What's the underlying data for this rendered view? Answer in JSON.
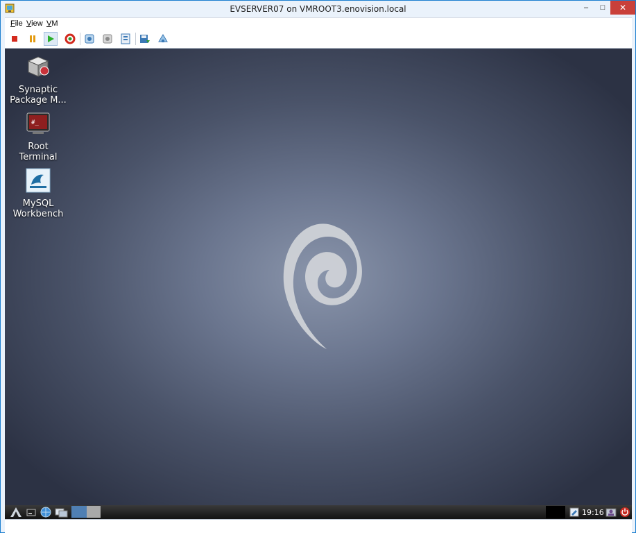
{
  "window": {
    "title": "EVSERVER07 on VMROOT3.enovision.local",
    "controls": {
      "minimize": "‒",
      "maximize": "□",
      "close": "✕"
    }
  },
  "menu": [
    {
      "label": "File",
      "key": "F",
      "rest": "ile"
    },
    {
      "label": "View",
      "key": "V",
      "rest": "iew"
    },
    {
      "label": "VM",
      "key": "V",
      "rest": "M"
    }
  ],
  "toolbar": {
    "icons": [
      "stop-icon",
      "pause-icon",
      "play-icon",
      "reset-icon",
      "snapshot-icon",
      "revert-icon",
      "settings-icon",
      "save-icon",
      "share-icon"
    ]
  },
  "desktop": {
    "icons": [
      {
        "label_line1": "Synaptic",
        "label_line2": "Package M..."
      },
      {
        "label_line1": "Root",
        "label_line2": "Terminal"
      },
      {
        "label_line1": "MySQL",
        "label_line2": "Workbench"
      }
    ]
  },
  "taskbar": {
    "clock": "19:16"
  },
  "colors": {
    "close_button": "#c9403a",
    "desktop_center": "#8a95ab",
    "desktop_edge": "#2c3244"
  }
}
